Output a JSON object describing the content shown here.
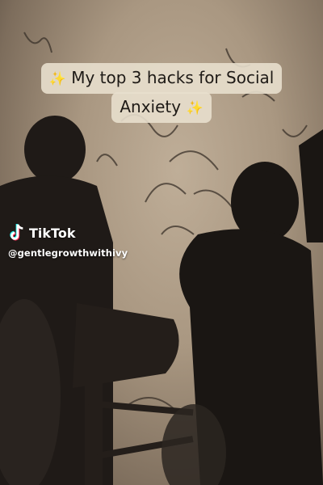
{
  "caption": {
    "line1_prefix": "✨",
    "line1_text": "My top 3 hacks for Social",
    "line2_text": "Anxiety",
    "line2_suffix": "✨"
  },
  "watermark": {
    "brand": "TikTok",
    "handle": "@gentlegrowthwithivy",
    "logo_icon": "tiktok-logo-icon"
  },
  "colors": {
    "caption_bg": "#e8dfcd",
    "caption_text": "#1e1a16",
    "sparkle": "#f3cf4a",
    "tiktok_cyan": "#25f4ee",
    "tiktok_red": "#fe2c55"
  }
}
